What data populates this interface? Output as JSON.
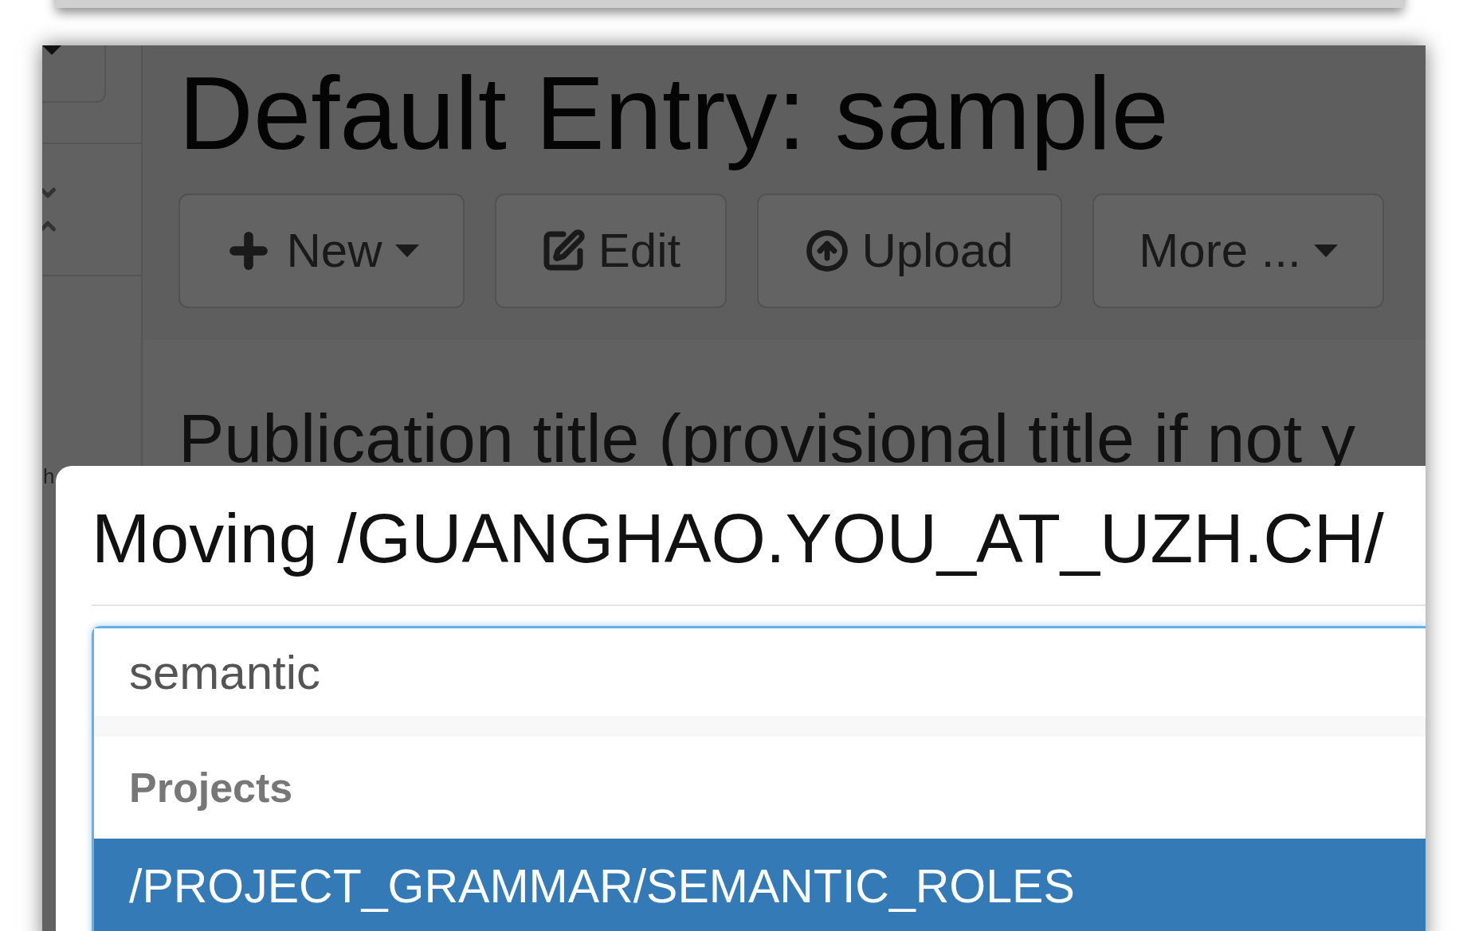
{
  "sidebar": {
    "text": "h"
  },
  "page": {
    "title": "Default Entry: sample",
    "toolbar": [
      {
        "label": "New",
        "kind": "plus",
        "dropdown": true
      },
      {
        "label": "Edit",
        "kind": "edit",
        "dropdown": false
      },
      {
        "label": "Upload",
        "kind": "upload",
        "dropdown": false
      },
      {
        "label": "More ...",
        "kind": "plain",
        "dropdown": true
      }
    ],
    "field_label": "Publication title (provisional title if not y"
  },
  "dialog": {
    "title": "Moving /GUANGHAO.YOU_AT_UZH.CH/",
    "search": {
      "value": "semantic"
    },
    "results": [
      {
        "group": "Projects",
        "items": [
          {
            "label": "/PROJECT_GRAMMAR/SEMANTIC_ROLES",
            "selected": true
          }
        ]
      }
    ]
  }
}
